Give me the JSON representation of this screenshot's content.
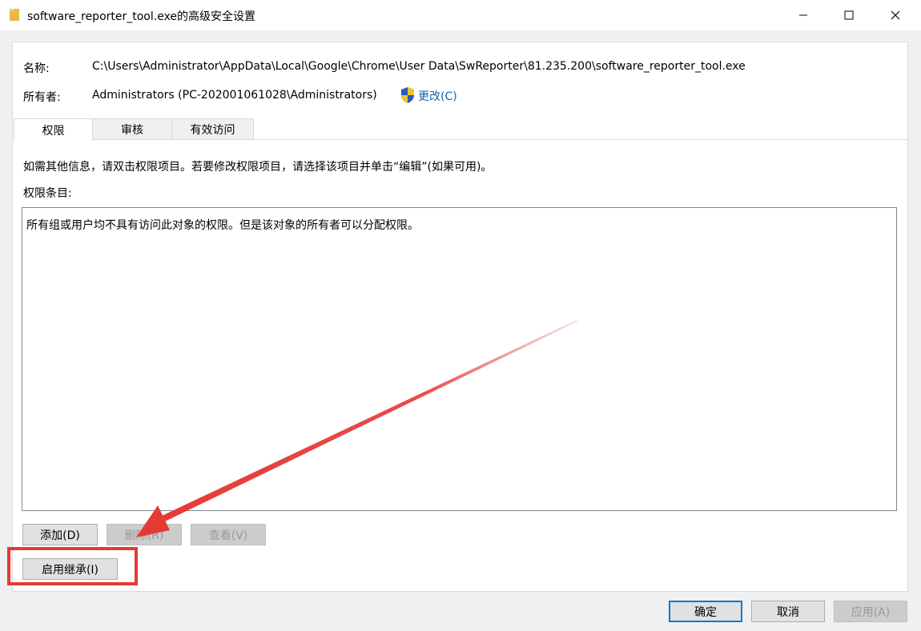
{
  "window": {
    "title": "software_reporter_tool.exe的高级安全设置"
  },
  "info": {
    "name_label": "名称:",
    "name_value": "C:\\Users\\Administrator\\AppData\\Local\\Google\\Chrome\\User Data\\SwReporter\\81.235.200\\software_reporter_tool.exe",
    "owner_label": "所有者:",
    "owner_value": "Administrators (PC-202001061028\\Administrators)",
    "change_link": "更改(C)"
  },
  "tabs": [
    {
      "label": "权限",
      "active": true
    },
    {
      "label": "审核",
      "active": false
    },
    {
      "label": "有效访问",
      "active": false
    }
  ],
  "permissions": {
    "info_text": "如需其他信息，请双击权限项目。若要修改权限项目，请选择该项目并单击“编辑”(如果可用)。",
    "entries_label": "权限条目:",
    "empty_message": "所有组或用户均不具有访问此对象的权限。但是该对象的所有者可以分配权限。"
  },
  "buttons": {
    "add": "添加(D)",
    "remove": "删除(R)",
    "view": "查看(V)",
    "enable_inheritance": "启用继承(I)",
    "ok": "确定",
    "cancel": "取消",
    "apply": "应用(A)"
  },
  "annotation": {
    "color": "#e53935"
  },
  "icons": {
    "folder": "folder-icon",
    "shield": "uac-shield-icon",
    "minimize": "minimize-icon",
    "maximize": "maximize-icon",
    "close": "close-icon"
  }
}
